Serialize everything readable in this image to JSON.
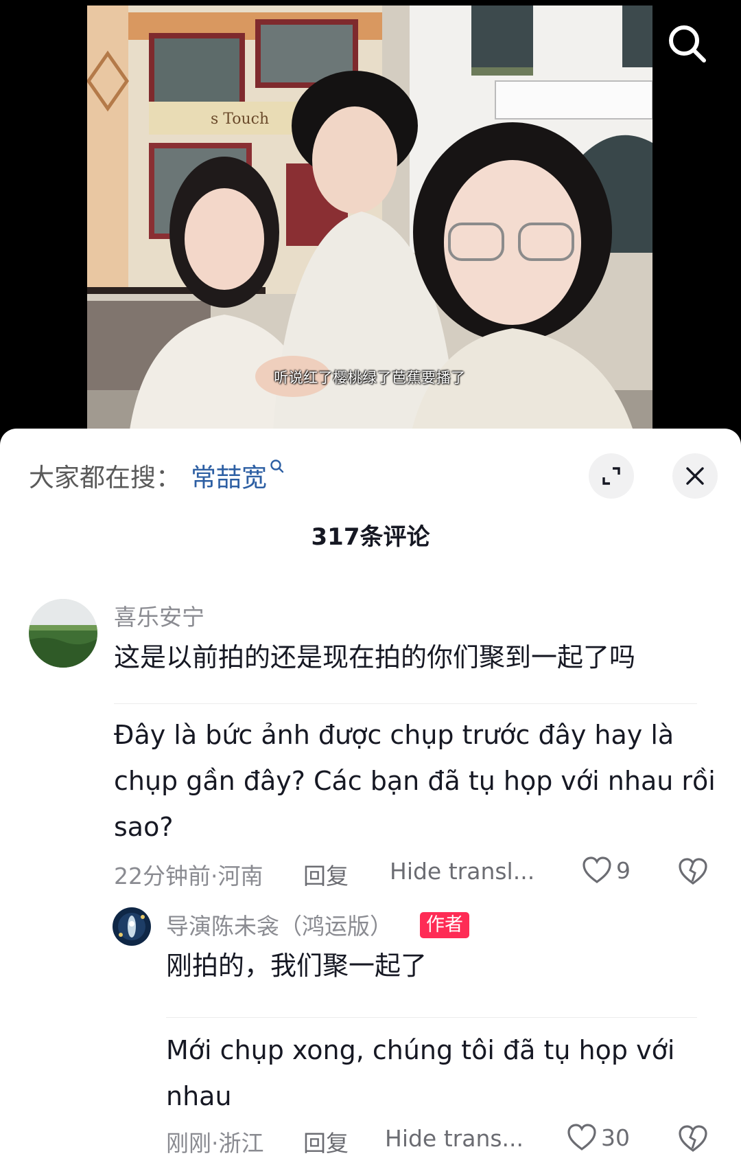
{
  "video": {
    "subtitle": "听说红了樱桃绿了芭蕉要播了",
    "storefront_sign": "s Touch"
  },
  "sheet": {
    "suggest_label": "大家都在搜：",
    "suggest_term": "常喆宽",
    "comment_count": "317条评论"
  },
  "comments": [
    {
      "username": "喜乐安宁",
      "text": "这是以前拍的还是现在拍的你们聚到一起了吗",
      "translation_line1": "Đây là bức ảnh được chụp trước đây hay là",
      "translation_line2": "chụp gần đây? Các bạn đã tụ họp với nhau rồi",
      "translation_line3": "sao?",
      "meta": "22分钟前·河南",
      "reply_label": "回复",
      "translate_label": "Hide transl...",
      "likes": "9"
    },
    {
      "username": "导演陈未衾（鸿运版）",
      "badge": "作者",
      "text": "刚拍的，我们聚一起了",
      "translation_line1": "Mới chụp xong, chúng tôi đã tụ họp với",
      "translation_line2": "nhau",
      "meta": "刚刚·浙江",
      "reply_label": "回复",
      "translate_label": "Hide trans...",
      "likes": "30"
    }
  ],
  "colors": {
    "accent_link": "#2d5fa3",
    "author_badge": "#fe2c55",
    "secondary_text": "#8a8b91",
    "primary_text": "#161823"
  },
  "icons": [
    "search-icon",
    "expand-icon",
    "close-icon",
    "small-search-icon",
    "heart-icon",
    "dislike-heart-icon"
  ]
}
